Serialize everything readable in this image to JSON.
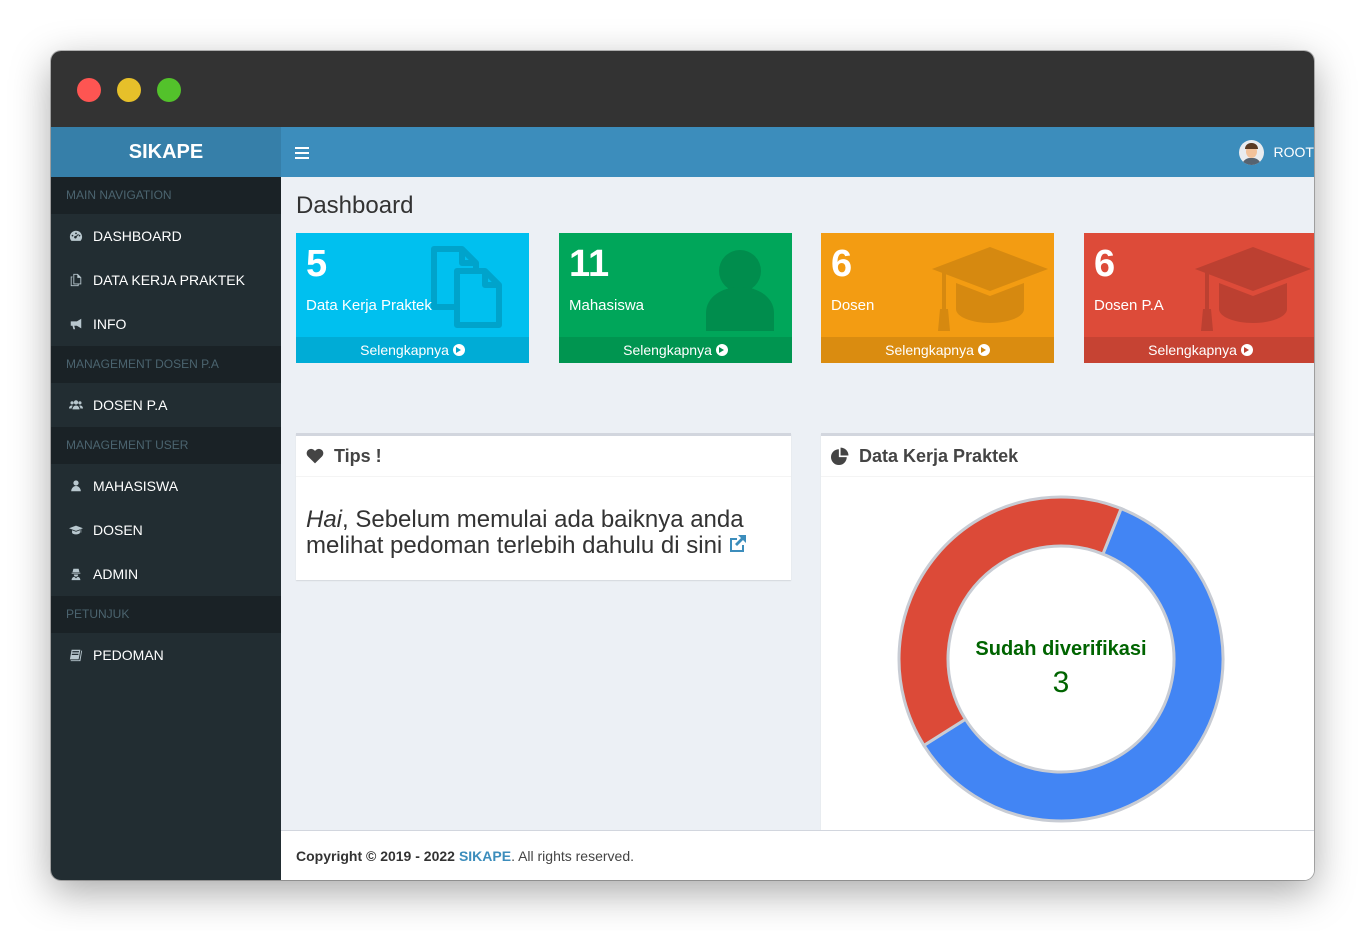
{
  "app": {
    "logo": "SIKAPE",
    "user_name": "ROOT"
  },
  "sidebar": {
    "sections": [
      {
        "header": "MAIN NAVIGATION",
        "items": [
          {
            "label": "DASHBOARD",
            "icon": "dashboard-icon"
          },
          {
            "label": "DATA KERJA PRAKTEK",
            "icon": "copy-icon"
          },
          {
            "label": "INFO",
            "icon": "bullhorn-icon"
          }
        ]
      },
      {
        "header": "MANAGEMENT DOSEN P.A",
        "items": [
          {
            "label": "DOSEN P.A",
            "icon": "users-icon"
          }
        ]
      },
      {
        "header": "MANAGEMENT USER",
        "items": [
          {
            "label": "MAHASISWA",
            "icon": "user-icon"
          },
          {
            "label": "DOSEN",
            "icon": "graduation-cap-icon"
          },
          {
            "label": "ADMIN",
            "icon": "user-secret-icon"
          }
        ]
      },
      {
        "header": "PETUNJUK",
        "items": [
          {
            "label": "PEDOMAN",
            "icon": "book-icon"
          }
        ]
      }
    ]
  },
  "page": {
    "title": "Dashboard"
  },
  "tiles": [
    {
      "value": "5",
      "label": "Data Kerja Praktek",
      "more": "Selengkapnya",
      "color": "#00c0ef",
      "icon": "copy-icon"
    },
    {
      "value": "11",
      "label": "Mahasiswa",
      "more": "Selengkapnya",
      "color": "#00a65a",
      "icon": "user-icon"
    },
    {
      "value": "6",
      "label": "Dosen",
      "more": "Selengkapnya",
      "color": "#f39c12",
      "icon": "graduation-cap-icon"
    },
    {
      "value": "6",
      "label": "Dosen P.A",
      "more": "Selengkapnya",
      "color": "#dd4b39",
      "icon": "graduation-cap-icon"
    }
  ],
  "tips": {
    "title": "Tips !",
    "greeting": "Hai",
    "text": ", Sebelum memulai ada baiknya anda melihat pedoman terlebih dahulu di sini"
  },
  "chart_panel": {
    "title": "Data Kerja Praktek"
  },
  "chart_data": {
    "type": "pie",
    "donut": true,
    "center_label": "Sudah diverifikasi",
    "center_value": "3",
    "slices": [
      {
        "value": 3,
        "color": "#4285f4"
      },
      {
        "value": 2,
        "color": "#dc4a38"
      }
    ]
  },
  "footer": {
    "copyright": "Copyright © 2019 - 2022",
    "brand": "SIKAPE",
    "suffix": ". All rights reserved."
  },
  "colors": {
    "primary": "#3c8dbc",
    "sidebar": "#222d32",
    "verified_text": "#006400"
  }
}
